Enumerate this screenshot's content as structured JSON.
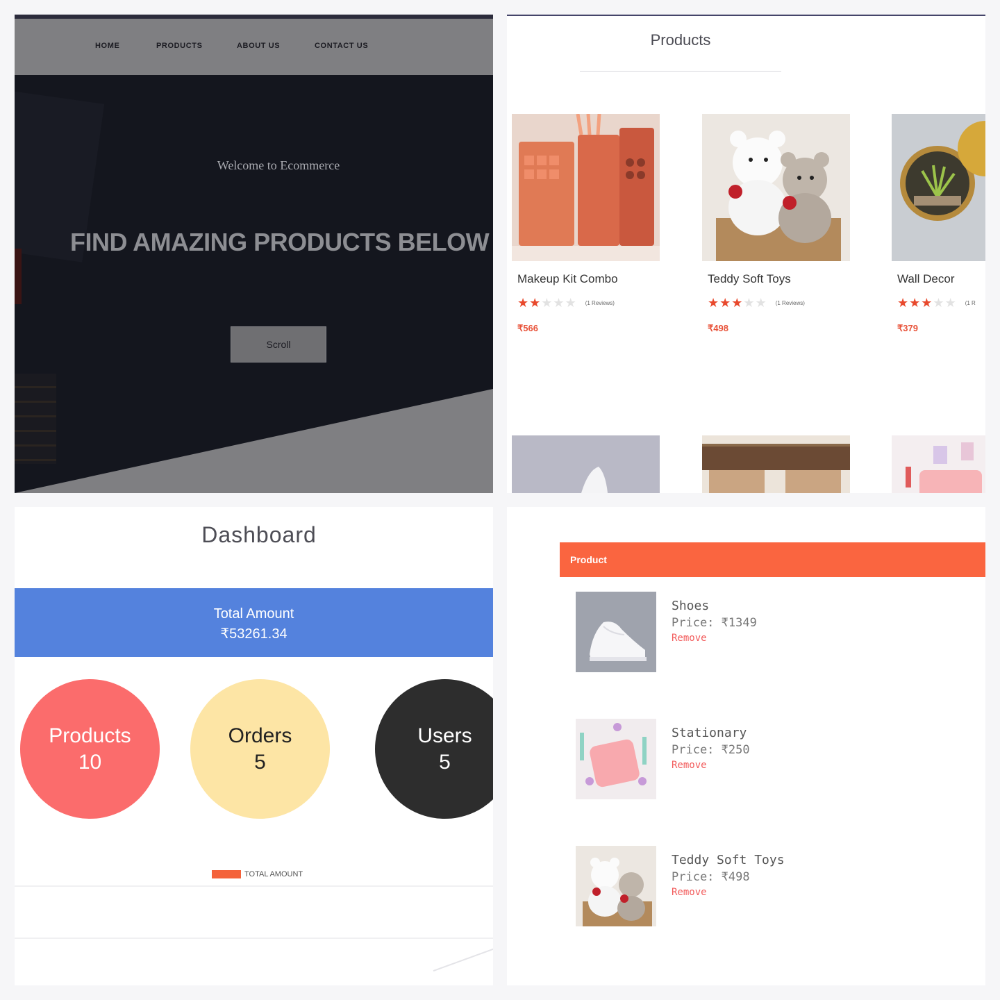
{
  "landing": {
    "nav": [
      "HOME",
      "PRODUCTS",
      "ABOUT US",
      "CONTACT US"
    ],
    "welcome": "Welcome to Ecommerce",
    "headline": "FIND AMAZING PRODUCTS BELOW",
    "scroll_button": "Scroll"
  },
  "products": {
    "title": "Products",
    "items": [
      {
        "name": "Makeup Kit Combo",
        "rating": 2,
        "reviews": "(1 Reviews)",
        "price": "₹566"
      },
      {
        "name": "Teddy Soft Toys",
        "rating": 3,
        "reviews": "(1 Reviews)",
        "price": "₹498"
      },
      {
        "name": "Wall Decor",
        "rating": 3,
        "reviews": "(1 R",
        "price": "₹379"
      }
    ],
    "colors": {
      "star": "#e8492d",
      "price": "#e8533a"
    }
  },
  "dashboard": {
    "title": "Dashboard",
    "total_label": "Total Amount",
    "total_value": "₹53261.34",
    "stats": [
      {
        "label": "Products",
        "value": "10",
        "color": "#fb6c6c"
      },
      {
        "label": "Orders",
        "value": "5",
        "color": "#fde5a5"
      },
      {
        "label": "Users",
        "value": "5",
        "color": "#2d2d2d"
      }
    ],
    "legend_label": "TOTAL AMOUNT",
    "colors": {
      "total_bar": "#5482dd",
      "legend": "#f4623a"
    }
  },
  "cart": {
    "header": "Product",
    "items": [
      {
        "name": "Shoes",
        "price": "Price: ₹1349",
        "remove": "Remove"
      },
      {
        "name": "Stationary",
        "price": "Price: ₹250",
        "remove": "Remove"
      },
      {
        "name": "Teddy Soft Toys",
        "price": "Price: ₹498",
        "remove": "Remove"
      }
    ],
    "colors": {
      "header": "#fa6540",
      "remove": "#f25b5b"
    }
  }
}
